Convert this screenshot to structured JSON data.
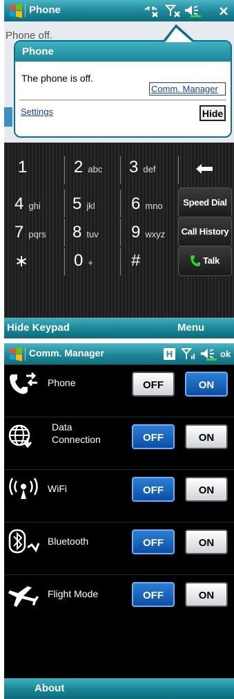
{
  "phone_screen": {
    "title": "Phone",
    "status_text": "Phone off.",
    "notification": {
      "title": "Phone",
      "message": "The phone is off.",
      "link_label": "Comm. Manager",
      "settings_label": "Settings",
      "hide_label": "Hide"
    },
    "keypad": {
      "keys": [
        {
          "digit": "1",
          "letters": ""
        },
        {
          "digit": "2",
          "letters": "abc"
        },
        {
          "digit": "3",
          "letters": "def"
        },
        {
          "digit": "4",
          "letters": "ghi"
        },
        {
          "digit": "5",
          "letters": "jkl"
        },
        {
          "digit": "6",
          "letters": "mno"
        },
        {
          "digit": "7",
          "letters": "pqrs"
        },
        {
          "digit": "8",
          "letters": "tuv"
        },
        {
          "digit": "9",
          "letters": "wxyz"
        },
        {
          "digit": "∗",
          "letters": ""
        },
        {
          "digit": "0",
          "letters": "+"
        },
        {
          "digit": "#",
          "letters": ""
        }
      ],
      "speed_dial_label": "Speed Dial",
      "call_history_label": "Call History",
      "talk_label": "Talk"
    },
    "softkeys": {
      "left": "Hide Keypad",
      "right": "Menu"
    }
  },
  "comm_manager_screen": {
    "title": "Comm. Manager",
    "ok_label": "ok",
    "status_letter": "H",
    "rows": [
      {
        "label": "Phone",
        "icon": "phone-icon",
        "off_label": "OFF",
        "on_label": "ON",
        "state": "ON"
      },
      {
        "label": "Data\nConnection",
        "icon": "globe-icon",
        "off_label": "OFF",
        "on_label": "ON",
        "state": "OFF"
      },
      {
        "label": "WiFi",
        "icon": "wifi-icon",
        "off_label": "OFF",
        "on_label": "ON",
        "state": "OFF"
      },
      {
        "label": "Bluetooth",
        "icon": "bluetooth-icon",
        "off_label": "OFF",
        "on_label": "ON",
        "state": "OFF"
      },
      {
        "label": "Flight Mode",
        "icon": "airplane-icon",
        "off_label": "OFF",
        "on_label": "ON",
        "state": "OFF"
      }
    ],
    "softkeys": {
      "left": "About"
    }
  },
  "colors": {
    "titlebar": "#1e8697",
    "active_toggle": "#1360b8",
    "link": "#1a3db0"
  }
}
